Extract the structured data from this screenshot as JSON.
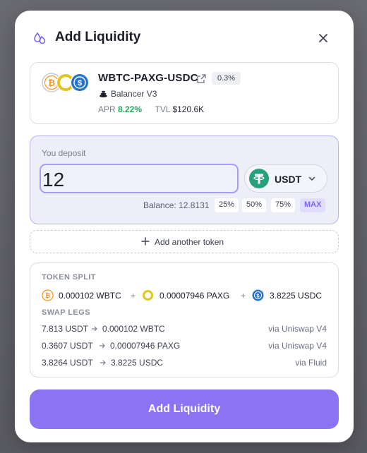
{
  "modal": {
    "title": "Add Liquidity",
    "close_icon": "close-icon",
    "header_icon": "droplets-icon"
  },
  "pool": {
    "name": "WBTC-PAXG-USDC",
    "fee": "0.3%",
    "protocol": "Balancer V3",
    "apr_label": "APR",
    "apr_value": "8.22%",
    "tvl_label": "TVL",
    "tvl_value": "$120.6K",
    "tokens": [
      "WBTC",
      "PAXG",
      "USDC"
    ]
  },
  "deposit": {
    "label": "You deposit",
    "amount": "12",
    "token": "USDT",
    "balance_label": "Balance: 12.8131",
    "percent_options": [
      "25%",
      "50%",
      "75%",
      "MAX"
    ]
  },
  "add_token": {
    "label": "Add another token"
  },
  "token_split": {
    "label": "TOKEN SPLIT",
    "items": [
      {
        "amount": "0.000102 WBTC",
        "icon": "wbtc-icon"
      },
      {
        "amount": "0.00007946 PAXG",
        "icon": "paxg-icon"
      },
      {
        "amount": "3.8225 USDC",
        "icon": "usdc-icon"
      }
    ],
    "separator": "+"
  },
  "swap_legs": {
    "label": "SWAP LEGS",
    "legs": [
      {
        "from": "7.813 USDT",
        "to": "0.000102 WBTC",
        "via": "via Uniswap V4"
      },
      {
        "from": "0.3607 USDT",
        "to": "0.00007946 PAXG",
        "via": "via Uniswap V4"
      },
      {
        "from": "3.8264 USDT",
        "to": "3.8225 USDC",
        "via": "via Fluid"
      }
    ]
  },
  "submit": {
    "label": "Add Liquidity"
  },
  "colors": {
    "accent": "#8b73f4",
    "apr_green": "#22a85a",
    "usdt_green": "#26a17b",
    "usdc_blue": "#2775ca",
    "btc_orange": "#f7931a",
    "paxg_gold": "#e4c51c"
  }
}
